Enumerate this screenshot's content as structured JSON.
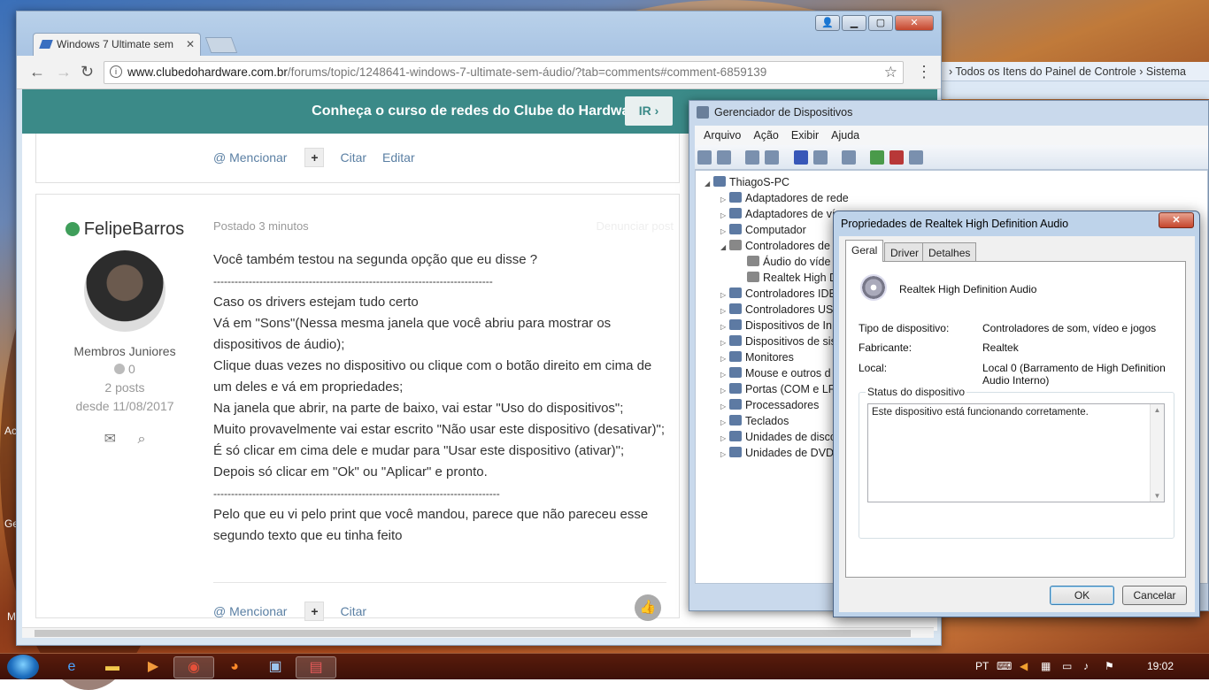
{
  "browser": {
    "tab_title": "Windows 7 Ultimate sem",
    "url_host": "www.clubedohardware.com.br",
    "url_path": "/forums/topic/1248641-windows-7-ultimate-sem-áudio/?tab=comments#comment-6859139",
    "back": "←",
    "forward": "→",
    "reload": "↻",
    "star": "☆",
    "menu": "⋮"
  },
  "banner": {
    "text": "Conheça o curso de redes do Clube do Hardware!",
    "button": "IR ›"
  },
  "post_top_actions": {
    "mention": "@ Mencionar",
    "plus": "+",
    "quote": "Citar",
    "edit": "Editar"
  },
  "post": {
    "author": "FelipeBarros",
    "rank": "Membros Juniores",
    "reputation": "0",
    "posts": "2 posts",
    "since": "desde 11/08/2017",
    "posted": "Postado 3 minutos",
    "share": "Denunciar post",
    "lines": [
      "Você também testou na segunda opção que eu disse ?",
      "-------------------------------------------------------------------------------",
      "Caso os drivers estejam tudo certo",
      "Vá em \"Sons\"(Nessa mesma janela que você abriu para mostrar os dispositivos de áudio);",
      "Clique duas vezes no dispositivo ou clique com o botão direito em cima de um deles e vá em propriedades;",
      "Na janela que abrir, na parte de baixo, vai estar \"Uso do dispositivos\";",
      "Muito provavelmente vai estar escrito \"Não usar este dispositivo (desativar)\";",
      "É só clicar em cima dele e mudar para \"Usar este dispositivo (ativar)\";",
      "Depois só clicar em \"Ok\" ou \"Aplicar\" e pronto.",
      "---------------------------------------------------------------------------------",
      "Pelo que eu vi pelo print que você mandou, parece que não pareceu esse segundo texto que eu tinha feito"
    ],
    "actions": {
      "mention": "@ Mencionar",
      "plus": "+",
      "quote": "Citar"
    }
  },
  "explorer": {
    "breadcrumb1": "Todos os Itens do Painel de Controle",
    "sep": "›",
    "breadcrumb2": "Sistema"
  },
  "devmgr": {
    "title": "Gerenciador de Dispositivos",
    "menu": [
      "Arquivo",
      "Ação",
      "Exibir",
      "Ajuda"
    ],
    "root": "ThiagoS-PC",
    "nodes": [
      "Adaptadores de rede",
      "Adaptadores de ví",
      "Computador",
      "Controladores de",
      "Áudio do víde",
      "Realtek High D",
      "Controladores IDE",
      "Controladores US",
      "Dispositivos de In",
      "Dispositivos de sis",
      "Monitores",
      "Mouse e outros d",
      "Portas (COM e LP",
      "Processadores",
      "Teclados",
      "Unidades de disco",
      "Unidades de DVD"
    ]
  },
  "props": {
    "title": "Propriedades de Realtek High Definition Audio",
    "close": "✕",
    "tabs": [
      "Geral",
      "Driver",
      "Detalhes"
    ],
    "device_name": "Realtek High Definition Audio",
    "type_label": "Tipo de dispositivo:",
    "type_value": "Controladores de som, vídeo e jogos",
    "maker_label": "Fabricante:",
    "maker_value": "Realtek",
    "local_label": "Local:",
    "local_value": "Local 0 (Barramento de High Definition Audio Interno)",
    "status_group": "Status do dispositivo",
    "status_text": "Este dispositivo está funcionando corretamente.",
    "ok": "OK",
    "cancel": "Cancelar"
  },
  "taskbar": {
    "lang": "PT",
    "time": "19:02"
  },
  "desktop_left": [
    "Ac",
    "Ge",
    "M"
  ]
}
